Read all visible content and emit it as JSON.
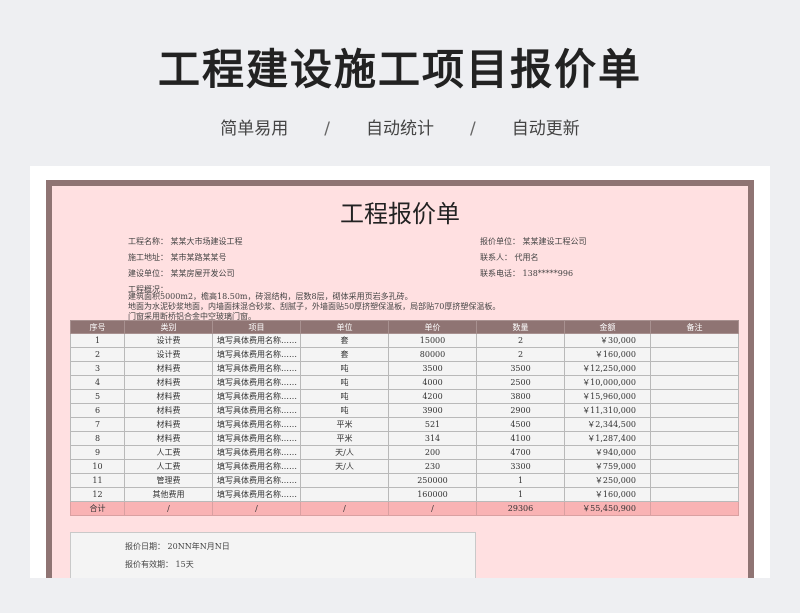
{
  "hero": {
    "title": "工程建设施工项目报价单",
    "features": [
      "简单易用",
      "自动统计",
      "自动更新"
    ],
    "separator": "/"
  },
  "doc": {
    "title": "工程报价单",
    "project_name": "工程名称：  某某大市场建设工程",
    "project_address": "施工地址：  某市某路某某号",
    "build_unit": "建设单位：  某某房屋开发公司",
    "quote_unit": "报价单位：  某某建设工程公司",
    "contact": "联系人：  代用名",
    "phone": "联系电话：  138*****996",
    "overview_label": "工程概况：",
    "overview_lines": [
      "建筑面积5000m2，檐高18.50m，砖混结构，层数8层，砌体采用页岩多孔砖。",
      "地面为水泥砂浆地面，内墙面抹混合砂浆、刮腻子，外墙面贴50厚挤塑保温板，局部贴70厚挤塑保温板。",
      "门窗采用断桥铝合金中空玻璃门窗。"
    ]
  },
  "table": {
    "headers": [
      "序号",
      "类别",
      "项目",
      "单位",
      "单价",
      "数量",
      "金额",
      "备注"
    ],
    "rows": [
      [
        "1",
        "设计费",
        "填写具体费用名称……",
        "套",
        "15000",
        "2",
        "￥30,000",
        ""
      ],
      [
        "2",
        "设计费",
        "填写具体费用名称……",
        "套",
        "80000",
        "2",
        "￥160,000",
        ""
      ],
      [
        "3",
        "材料费",
        "填写具体费用名称……",
        "吨",
        "3500",
        "3500",
        "￥12,250,000",
        ""
      ],
      [
        "4",
        "材料费",
        "填写具体费用名称……",
        "吨",
        "4000",
        "2500",
        "￥10,000,000",
        ""
      ],
      [
        "5",
        "材料费",
        "填写具体费用名称……",
        "吨",
        "4200",
        "3800",
        "￥15,960,000",
        ""
      ],
      [
        "6",
        "材料费",
        "填写具体费用名称……",
        "吨",
        "3900",
        "2900",
        "￥11,310,000",
        ""
      ],
      [
        "7",
        "材料费",
        "填写具体费用名称……",
        "平米",
        "521",
        "4500",
        "￥2,344,500",
        ""
      ],
      [
        "8",
        "材料费",
        "填写具体费用名称……",
        "平米",
        "314",
        "4100",
        "￥1,287,400",
        ""
      ],
      [
        "9",
        "人工费",
        "填写具体费用名称……",
        "天/人",
        "200",
        "4700",
        "￥940,000",
        ""
      ],
      [
        "10",
        "人工费",
        "填写具体费用名称……",
        "天/人",
        "230",
        "3300",
        "￥759,000",
        ""
      ],
      [
        "11",
        "管理费",
        "填写具体费用名称……",
        "",
        "250000",
        "1",
        "￥250,000",
        ""
      ],
      [
        "12",
        "其他费用",
        "填写具体费用名称……",
        "",
        "160000",
        "1",
        "￥160,000",
        ""
      ]
    ],
    "total": [
      "合计",
      "/",
      "/",
      "/",
      "/",
      "29306",
      "￥55,450,900",
      ""
    ]
  },
  "footer": {
    "quote_date": "报价日期：  20NN年N月N日",
    "validity": "报价有效期：  15天"
  },
  "colors": {
    "page_bg": "#eeeff2",
    "sheet_bg": "#ffe0e1",
    "frame": "#8f7473",
    "total_row": "#f9b3b4"
  }
}
